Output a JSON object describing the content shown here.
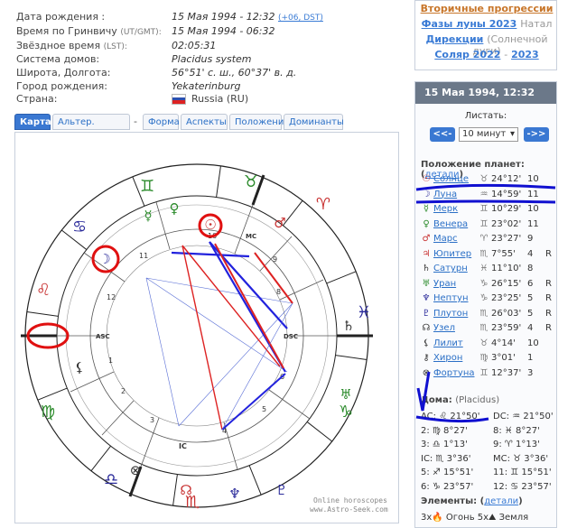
{
  "info": [
    {
      "label": "Дата рождения :",
      "value": "15 Мая 1994 - 12:32",
      "extra": "(+06, DST)"
    },
    {
      "label": "Время по Гринвичу",
      "label_small": "(UT/GMT):",
      "value": "15 Мая 1994 - 06:32"
    },
    {
      "label": "Звёздное время",
      "label_small": "(LST):",
      "value": "02:05:31"
    },
    {
      "label": "Система домов:",
      "value": "Placidus system"
    },
    {
      "label": "Широта, Долгота:",
      "value": "56°51' с. ш., 60°37' в. д."
    },
    {
      "label": "Город рождения:",
      "value": "Yekaterinburg"
    },
    {
      "label": "Страна:",
      "value": "Russia (RU)"
    }
  ],
  "tabs": [
    "Карта",
    "Альтер. графика",
    "-",
    "Форма",
    "Аспекты",
    "Положение",
    "Доминанты"
  ],
  "chart": {
    "watermark1": "Online horoscopes",
    "watermark2": "www.Astro-Seek.com",
    "asc_label": "ASC",
    "dsc_label": "DSC",
    "mc_label": "MC",
    "ic_label": "IC",
    "houses": [
      "1",
      "2",
      "3",
      "4",
      "5",
      "6",
      "7",
      "8",
      "9",
      "10",
      "11",
      "12"
    ]
  },
  "top_links": [
    {
      "text": "Вторичные прогрессии"
    },
    {
      "text": "Фазы луны 2023",
      "tail": "Натал"
    },
    {
      "text": "Дирекции",
      "tail": "(Солнечной дуги)"
    },
    {
      "text": "Соляр 2022",
      "sep": "-",
      "text2": "2023"
    }
  ],
  "panel": {
    "header": "15 Мая 1994, 12:32",
    "scroll_label": "Листать:",
    "prev": "<<-",
    "next": "->>",
    "step": "10 минут",
    "planets_title": "Положение планет:",
    "planets_link": "детали",
    "planets": [
      {
        "sym": "☉",
        "name": "Солнце",
        "zsym": "♉",
        "deg": "24°12'",
        "house": "10",
        "r": ""
      },
      {
        "sym": "☽",
        "name": "Луна",
        "zsym": "♒",
        "deg": "14°59'",
        "house": "11",
        "r": ""
      },
      {
        "sym": "☿",
        "name": "Мерк",
        "zsym": "♊",
        "deg": "10°29'",
        "house": "10",
        "r": ""
      },
      {
        "sym": "♀",
        "name": "Венера",
        "zsym": "♊",
        "deg": "23°02'",
        "house": "11",
        "r": ""
      },
      {
        "sym": "♂",
        "name": "Марс",
        "zsym": "♈",
        "deg": "23°27'",
        "house": "9",
        "r": ""
      },
      {
        "sym": "♃",
        "name": "Юпитер",
        "zsym": "♏",
        "deg": "7°55'",
        "house": "4",
        "r": "R"
      },
      {
        "sym": "♄",
        "name": "Сатурн",
        "zsym": "♓",
        "deg": "11°10'",
        "house": "8",
        "r": ""
      },
      {
        "sym": "♅",
        "name": "Уран",
        "zsym": "♑",
        "deg": "26°15'",
        "house": "6",
        "r": "R"
      },
      {
        "sym": "♆",
        "name": "Нептун",
        "zsym": "♑",
        "deg": "23°25'",
        "house": "5",
        "r": "R"
      },
      {
        "sym": "♇",
        "name": "Плутон",
        "zsym": "♏",
        "deg": "26°03'",
        "house": "5",
        "r": "R"
      },
      {
        "sym": "☊",
        "name": "Узел",
        "zsym": "♏",
        "deg": "23°59'",
        "house": "4",
        "r": "R"
      },
      {
        "sym": "⚸",
        "name": "Лилит",
        "zsym": "♉",
        "deg": "4°14'",
        "house": "10",
        "r": ""
      },
      {
        "sym": "⚷",
        "name": "Хирон",
        "zsym": "♍",
        "deg": "3°01'",
        "house": "1",
        "r": ""
      },
      {
        "sym": "⊗",
        "name": "Фортуна",
        "zsym": "♊",
        "deg": "12°37'",
        "house": "3",
        "r": ""
      }
    ],
    "houses_title": "Дома:",
    "houses_sub": "(Placidus)",
    "houses": [
      {
        "a": "AC: ♌ 21°50'",
        "b": "DC: ♒ 21°50'"
      },
      {
        "a": "2: ♍ 8°27'",
        "b": "8: ♓ 8°27'"
      },
      {
        "a": "3: ♎ 1°13'",
        "b": "9: ♈ 1°13'"
      },
      {
        "a": "IC: ♏ 3°36'",
        "b": "MC: ♉ 3°36'"
      },
      {
        "a": "5: ♐ 15°51'",
        "b": "11: ♊ 15°51'"
      },
      {
        "a": "6: ♑ 23°57'",
        "b": "12: ♋ 23°57'"
      }
    ],
    "elements_title": "Элементы:",
    "elements_link": "детали",
    "elements_line": "3x🔥 Огонь    5x⛰ Земля"
  }
}
